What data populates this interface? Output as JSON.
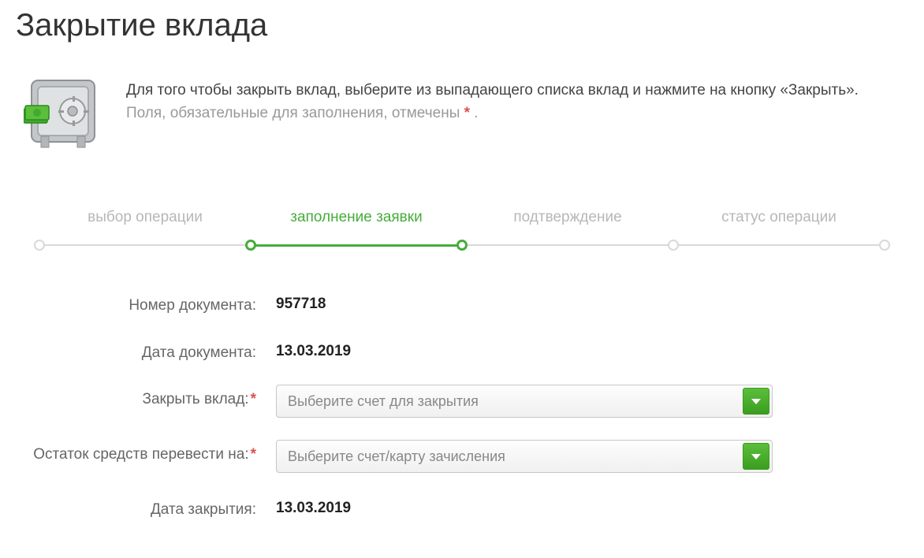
{
  "title": "Закрытие вклада",
  "intro": {
    "main": "Для того чтобы закрыть вклад, выберите из выпадающего списка вклад и нажмите на кнопку «Закрыть».",
    "hint_prefix": "Поля, обязательные для заполнения, отмечены ",
    "hint_suffix": " ."
  },
  "progress": {
    "steps": [
      "выбор операции",
      "заполнение заявки",
      "подтверждение",
      "статус операции"
    ],
    "active_index": 1
  },
  "form": {
    "doc_number_label": "Номер документа:",
    "doc_number_value": "957718",
    "doc_date_label": "Дата документа:",
    "doc_date_value": "13.03.2019",
    "close_deposit_label": "Закрыть вклад:",
    "close_deposit_placeholder": "Выберите счет для закрытия",
    "transfer_to_label": "Остаток средств перевести на:",
    "transfer_to_placeholder": "Выберите счет/карту зачисления",
    "close_date_label": "Дата закрытия:",
    "close_date_value": "13.03.2019"
  },
  "colors": {
    "accent_green": "#46ad39"
  }
}
